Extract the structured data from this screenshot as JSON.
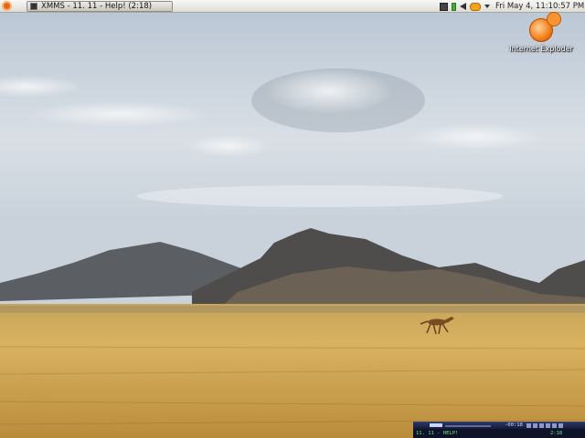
{
  "top_panel": {
    "task_button": {
      "label": "XMMS - 11. 11 - Help! (2:18)"
    },
    "tray_icons": [
      "network-icon",
      "battery-icon",
      "volume-icon",
      "update-icon",
      "chevron-down-icon"
    ],
    "clock": "Fri May  4, 11:10:57 PM"
  },
  "desktop": {
    "icons": [
      {
        "label": "Internet Exploder",
        "icon": "ie-icon"
      }
    ]
  },
  "xmms_player": {
    "elapsed": "-00:18",
    "track": "11. 11 - HELP!",
    "track_time": "2:18"
  },
  "colors": {
    "panel": "#dedcd6",
    "sky": "#c8d3df",
    "grass": "#c9a049",
    "ubuntu_orange": "#e26b12",
    "xmms_bg": "#0e1328",
    "xmms_text": "#6fe28a"
  }
}
